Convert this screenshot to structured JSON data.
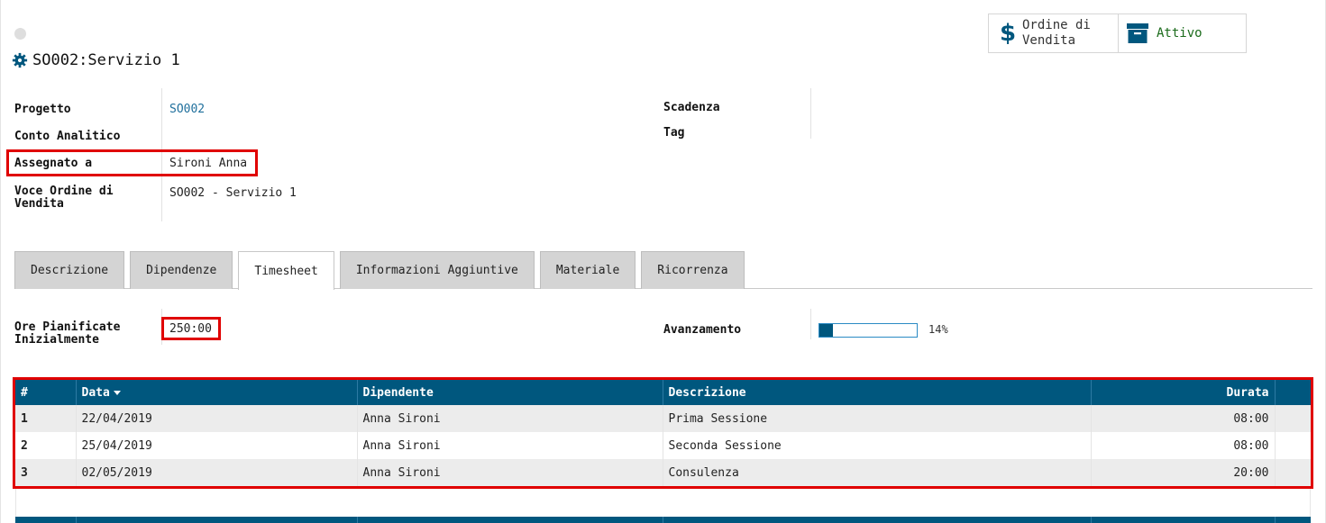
{
  "header": {
    "title": "SO002:Servizio 1",
    "title_icon": "gear-icon"
  },
  "smart_buttons": {
    "order": {
      "label_line1": "Ordine di",
      "label_line2": "Vendita",
      "icon": "dollar-icon"
    },
    "active": {
      "label": "Attivo",
      "icon": "archive-icon"
    }
  },
  "fields": {
    "progetto": {
      "label": "Progetto",
      "value": "SO002"
    },
    "conto": {
      "label": "Conto Analitico",
      "value": ""
    },
    "assegnato": {
      "label": "Assegnato a",
      "value": "Sironi Anna"
    },
    "voce": {
      "label_line1": "Voce Ordine di",
      "label_line2": "Vendita",
      "value": "SO002 - Servizio 1"
    },
    "scadenza": {
      "label": "Scadenza",
      "value": ""
    },
    "tag": {
      "label": "Tag",
      "value": ""
    }
  },
  "tabs": [
    {
      "label": "Descrizione"
    },
    {
      "label": "Dipendenze"
    },
    {
      "label": "Timesheet",
      "active": true
    },
    {
      "label": "Informazioni Aggiuntive"
    },
    {
      "label": "Materiale"
    },
    {
      "label": "Ricorrenza"
    }
  ],
  "timesheet": {
    "ore_label_line1": "Ore Pianificate",
    "ore_label_line2": "Inizialmente",
    "ore_value": "250:00",
    "avanzamento_label": "Avanzamento",
    "avanzamento_percent": 14,
    "avanzamento_text": "14%"
  },
  "table": {
    "headers": {
      "num": "#",
      "data": "Data",
      "dipendente": "Dipendente",
      "descrizione": "Descrizione",
      "durata": "Durata"
    },
    "rows": [
      {
        "num": "1",
        "data": "22/04/2019",
        "dipendente": "Anna Sironi",
        "descrizione": "Prima Sessione",
        "durata": "08:00"
      },
      {
        "num": "2",
        "data": "25/04/2019",
        "dipendente": "Anna Sironi",
        "descrizione": "Seconda Sessione",
        "durata": "08:00"
      },
      {
        "num": "3",
        "data": "02/05/2019",
        "dipendente": "Anna Sironi",
        "descrizione": "Consulenza",
        "durata": "20:00"
      }
    ]
  },
  "colors": {
    "primary": "#00577e",
    "highlight": "#e00000",
    "active_text": "#1b6b1b"
  }
}
